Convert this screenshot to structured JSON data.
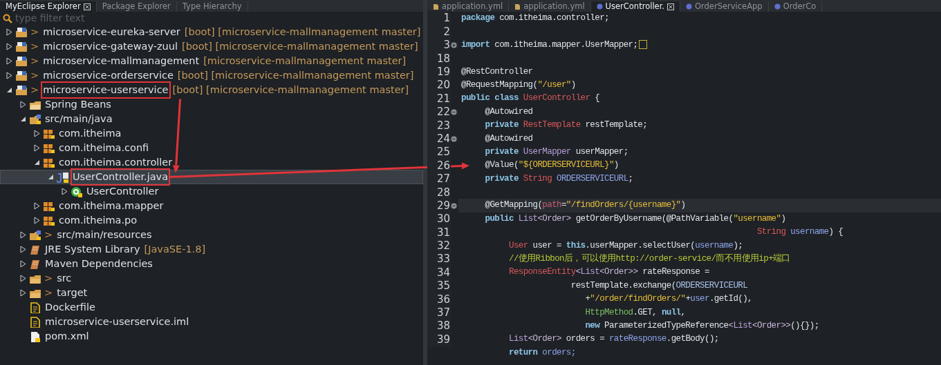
{
  "explorer": {
    "tabs": [
      {
        "label": "MyEclipse Explorer",
        "selected": true,
        "closable": true
      },
      {
        "label": "Package Explorer",
        "selected": false,
        "closable": false
      },
      {
        "label": "Type Hierarchy",
        "selected": false,
        "closable": false
      }
    ],
    "filter": {
      "placeholder": "type filter text"
    },
    "tree": [
      {
        "kind": "project",
        "marker": ">",
        "label": "microservice-eureka-server",
        "decoration": "[boot] [microservice-mallmanagement master]",
        "expanded": false,
        "selected": false
      },
      {
        "kind": "project",
        "marker": ">",
        "label": "microservice-gateway-zuul",
        "decoration": "[boot] [microservice-mallmanagement master]",
        "expanded": false,
        "selected": false
      },
      {
        "kind": "project",
        "marker": ">",
        "label": "microservice-mallmanagement",
        "decoration": "[microservice-mallmanagement master]",
        "expanded": false,
        "selected": false
      },
      {
        "kind": "project",
        "marker": ">",
        "label": "microservice-orderservice",
        "decoration": "[boot] [microservice-mallmanagement master]",
        "expanded": false,
        "selected": false
      },
      {
        "kind": "project",
        "marker": ">",
        "label": "microservice-userservice",
        "decoration": "[boot] [microservice-mallmanagement master]",
        "expanded": true,
        "selected": false,
        "highlighted": true,
        "children": [
          {
            "kind": "springfolder",
            "label": "Spring Beans",
            "expanded": false,
            "selected": false
          },
          {
            "kind": "srcfolder",
            "label": "src/main/java",
            "expanded": true,
            "selected": false,
            "children": [
              {
                "kind": "package",
                "label": "com.itheima",
                "expanded": false,
                "selected": false
              },
              {
                "kind": "package",
                "label": "com.itheima.confi",
                "expanded": false,
                "selected": false
              },
              {
                "kind": "package",
                "label": "com.itheima.controller",
                "expanded": true,
                "selected": false,
                "children": [
                  {
                    "kind": "javafile",
                    "label": "UserController.java",
                    "expanded": true,
                    "selected": true,
                    "highlighted": true,
                    "children": [
                      {
                        "kind": "class",
                        "label": "UserController",
                        "expanded": false,
                        "selected": false
                      }
                    ]
                  }
                ]
              },
              {
                "kind": "package",
                "label": "com.itheima.mapper",
                "expanded": false,
                "selected": false
              },
              {
                "kind": "package",
                "label": "com.itheima.po",
                "expanded": false,
                "selected": false
              }
            ]
          },
          {
            "kind": "srcfolder",
            "marker": ">",
            "label": "src/main/resources",
            "expanded": false,
            "selected": false
          },
          {
            "kind": "library",
            "label": "JRE System Library",
            "decoration": "[JavaSE-1.8]",
            "expanded": false,
            "selected": false
          },
          {
            "kind": "library",
            "label": "Maven Dependencies",
            "expanded": false,
            "selected": false
          },
          {
            "kind": "folder",
            "marker": ">",
            "label": "src",
            "expanded": false,
            "selected": false
          },
          {
            "kind": "folder",
            "marker": ">",
            "label": "target",
            "expanded": false,
            "selected": false
          },
          {
            "kind": "file",
            "label": "Dockerfile",
            "selected": false
          },
          {
            "kind": "file",
            "label": "microservice-userservice.iml",
            "selected": false
          },
          {
            "kind": "xmlfile",
            "label": "pom.xml",
            "selected": false
          }
        ]
      }
    ]
  },
  "editor": {
    "tabs": [
      {
        "label": "application.yml",
        "kind": "yaml",
        "selected": false
      },
      {
        "label": "application.yml",
        "kind": "yaml",
        "selected": false
      },
      {
        "label": "UserController.",
        "kind": "java",
        "selected": true
      },
      {
        "label": "OrderServiceApp",
        "kind": "java",
        "selected": false
      },
      {
        "label": "OrderCo",
        "kind": "java",
        "selected": false
      }
    ],
    "lines": [
      {
        "number": "1",
        "tokens": [
          {
            "kind": "keyword",
            "text": "package"
          },
          {
            "text": " com.itheima.controller;"
          }
        ]
      },
      {
        "number": "2"
      },
      {
        "number": "3",
        "collapsed": true,
        "tokens": [
          {
            "kind": "keyword",
            "text": "import"
          },
          {
            "text": " com.itheima.mapper.UserMapper;"
          }
        ]
      },
      {
        "number": "18"
      },
      {
        "number": "19",
        "tokens": [
          {
            "text": "@RestController"
          }
        ]
      },
      {
        "number": "20",
        "tokens": [
          {
            "text": "@RequestMapping("
          },
          {
            "kind": "string",
            "text": "\"/user\""
          },
          {
            "text": ")"
          }
        ]
      },
      {
        "number": "21",
        "tokens": [
          {
            "kind": "keyword",
            "text": "public class"
          },
          {
            "kind": "type",
            "text": " UserController"
          },
          {
            "text": " {"
          }
        ]
      },
      {
        "number": "22",
        "collapsed": false,
        "tokens": [
          {
            "text": "     @Autowired"
          }
        ]
      },
      {
        "number": "23",
        "tokens": [
          {
            "kind": "keyword",
            "text": "     private"
          },
          {
            "kind": "type",
            "text": " RestTemplate"
          },
          {
            "text": " restTemplate;"
          }
        ]
      },
      {
        "number": "24",
        "collapsed": false,
        "tokens": [
          {
            "text": "     @Autowired"
          }
        ]
      },
      {
        "number": "25",
        "tokens": [
          {
            "kind": "keyword",
            "text": "     private"
          },
          {
            "kind": "interface",
            "text": " UserMapper"
          },
          {
            "text": " userMapper;"
          }
        ]
      },
      {
        "number": "26",
        "arrow_target": true,
        "tokens": [
          {
            "text": "     @Value("
          },
          {
            "kind": "string",
            "text": "\"${ORDERSERVICEURL}\""
          },
          {
            "text": ")"
          }
        ]
      },
      {
        "number": "27",
        "tokens": [
          {
            "kind": "keyword",
            "text": "     private"
          },
          {
            "kind": "type",
            "text": " String"
          },
          {
            "kind": "field",
            "text": " ORDERSERVICEURL"
          },
          {
            "text": ";"
          }
        ]
      },
      {
        "number": "28"
      },
      {
        "number": "29",
        "collapsed": false,
        "current": true,
        "tokens": [
          {
            "text": "     @GetMapping("
          },
          {
            "kind": "param",
            "text": "path"
          },
          {
            "text": "="
          },
          {
            "kind": "string",
            "text": "\"/findOrders/{username}\""
          },
          {
            "text": ")"
          }
        ]
      },
      {
        "number": "30",
        "tokens": [
          {
            "kind": "keyword",
            "text": "     public"
          },
          {
            "kind": "interface",
            "text": " List"
          },
          {
            "kind": "generic",
            "text": "<Order>"
          },
          {
            "text": " getOrderByUsername(@PathVariable("
          },
          {
            "kind": "string",
            "text": "\"username\""
          },
          {
            "text": ")"
          }
        ]
      },
      {
        "number": "31",
        "tokens": [
          {
            "kind": "type",
            "text": "                                                              String"
          },
          {
            "kind": "field",
            "text": " username"
          },
          {
            "text": ") {"
          }
        ]
      },
      {
        "number": "32",
        "tokens": [
          {
            "kind": "type",
            "text": "          User"
          },
          {
            "text": " user = "
          },
          {
            "kind": "keyword",
            "text": "this"
          },
          {
            "text": ".userMapper.selectUser("
          },
          {
            "kind": "field",
            "text": "username"
          },
          {
            "text": ");"
          }
        ]
      },
      {
        "number": "33",
        "tokens": [
          {
            "kind": "comment",
            "text": "          //使用Ribbon后，可以使用http://order-service/而不用使用ip+端口"
          }
        ]
      },
      {
        "number": "34",
        "tokens": [
          {
            "kind": "type",
            "text": "          ResponseEntity"
          },
          {
            "kind": "generic",
            "text": "<"
          },
          {
            "kind": "interface",
            "text": "List"
          },
          {
            "kind": "generic",
            "text": "<Order>>"
          },
          {
            "text": " rateResponse ="
          }
        ]
      },
      {
        "number": "35",
        "tokens": [
          {
            "text": "                       restTemplate.exchange("
          },
          {
            "kind": "constant",
            "text": "ORDERSERVICEURL"
          }
        ]
      },
      {
        "number": "36",
        "tokens": [
          {
            "text": "                          +"
          },
          {
            "kind": "string",
            "text": "\"/order/findOrders/\""
          },
          {
            "text": "+"
          },
          {
            "kind": "field",
            "text": "user"
          },
          {
            "text": ".getId(),"
          }
        ]
      },
      {
        "number": "37",
        "tokens": [
          {
            "kind": "enum",
            "text": "                          HttpMethod"
          },
          {
            "text": ".GET, "
          },
          {
            "kind": "keyword",
            "text": "null"
          },
          {
            "text": ","
          }
        ]
      },
      {
        "number": "38",
        "tokens": [
          {
            "kind": "keyword",
            "text": "                          new"
          },
          {
            "text": " ParameterizedTypeReference"
          },
          {
            "kind": "generic",
            "text": "<"
          },
          {
            "kind": "interface",
            "text": "List"
          },
          {
            "kind": "generic",
            "text": "<Order>>"
          },
          {
            "text": "(){});"
          }
        ]
      },
      {
        "number": "39",
        "tokens": [
          {
            "kind": "interface",
            "text": "          List"
          },
          {
            "kind": "generic",
            "text": "<Order>"
          },
          {
            "text": " orders = "
          },
          {
            "kind": "field",
            "text": "rateResponse"
          },
          {
            "text": ".getBody();"
          }
        ]
      },
      {
        "tokens": [
          {
            "kind": "keyword",
            "text": "          return"
          },
          {
            "kind": "field",
            "text": " orders;"
          }
        ]
      }
    ]
  }
}
